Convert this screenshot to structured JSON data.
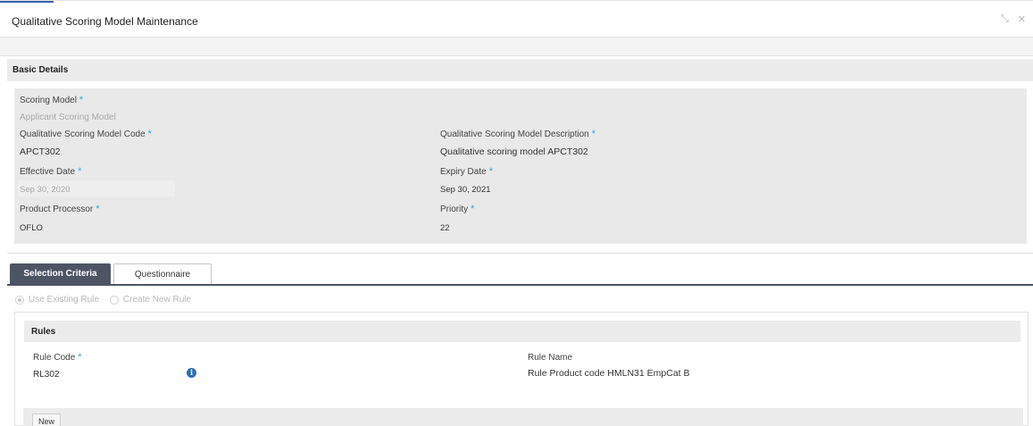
{
  "window": {
    "title": "Qualitative Scoring Model Maintenance",
    "icons": [
      "minimize-icon",
      "close-icon"
    ]
  },
  "basic_details": {
    "header": "Basic Details",
    "scoring_model": {
      "label": "Scoring Model",
      "required": "*",
      "value": "Applicant Scoring Model"
    },
    "model_code": {
      "label": "Qualitative Scoring Model Code",
      "required": "*",
      "value": "APCT302"
    },
    "model_description": {
      "label": "Qualitative Scoring Model Description",
      "required": "*",
      "value": "Qualitative scoring model APCT302"
    },
    "effective_date": {
      "label": "Effective Date",
      "required": "*",
      "value": "Sep 30, 2020"
    },
    "expiry_date": {
      "label": "Expiry Date",
      "required": "*",
      "value": "Sep 30, 2021"
    },
    "product_processor": {
      "label": "Product Processor",
      "required": "*",
      "value": "OFLO"
    },
    "priority": {
      "label": "Priority",
      "required": "*",
      "value": "22"
    }
  },
  "tabs": [
    {
      "label": "Selection Criteria",
      "active": true
    },
    {
      "label": "Questionnaire",
      "active": false
    }
  ],
  "rule_options": [
    {
      "label": "Use Existing Rule",
      "selected": true
    },
    {
      "label": "Create New Rule",
      "selected": false
    }
  ],
  "rules": {
    "header": "Rules",
    "rule_code": {
      "label": "Rule Code",
      "required": "*",
      "value": "RL302"
    },
    "rule_name": {
      "label": "Rule Name",
      "value": "Rule Product code HMLN31 EmpCat B"
    },
    "info_icon": "i",
    "new_button": "New"
  },
  "colors": {
    "active_tab": "#4d5565",
    "required_star": "#39a3d8",
    "info_icon": "#2a6fb5"
  }
}
